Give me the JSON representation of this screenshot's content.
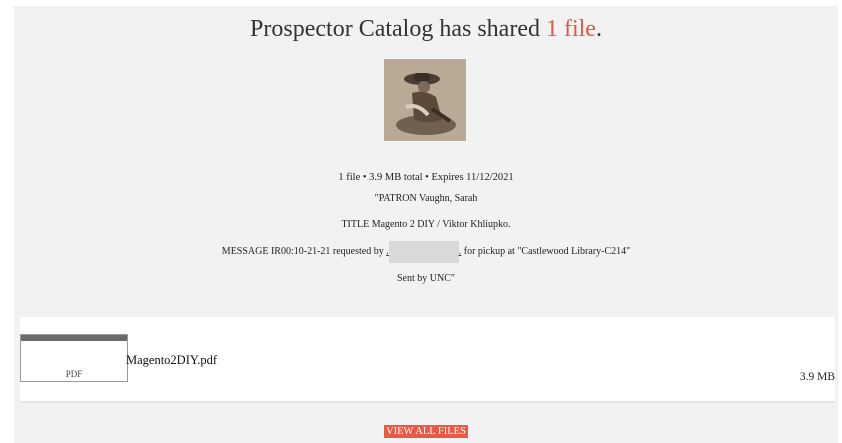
{
  "headline": {
    "prefix": "Prospector Catalog has shared ",
    "count": "1 file",
    "suffix": "."
  },
  "summary": "1 file • 3.9 MB total • Expires 11/12/2021",
  "patron": "\"PATRON Vaughn, Sarah",
  "title_line": "TITLE Magento 2 DIY / Viktor Khliupko.",
  "message": {
    "before": "MESSAGE IR00:10-21-21 requested by ",
    "link_left": ".",
    "link_right": ".",
    "after": " for pickup at \"Castlewood Library-C214\""
  },
  "sent_by": "Sent by UNC\"",
  "file": {
    "type": "PDF",
    "name": "Magento2DIY.pdf",
    "size": "3.9 MB"
  },
  "view_all_label": "VIEW ALL FILES",
  "colors": {
    "accent": "#e85a43",
    "panel": "#f2f2f2"
  }
}
